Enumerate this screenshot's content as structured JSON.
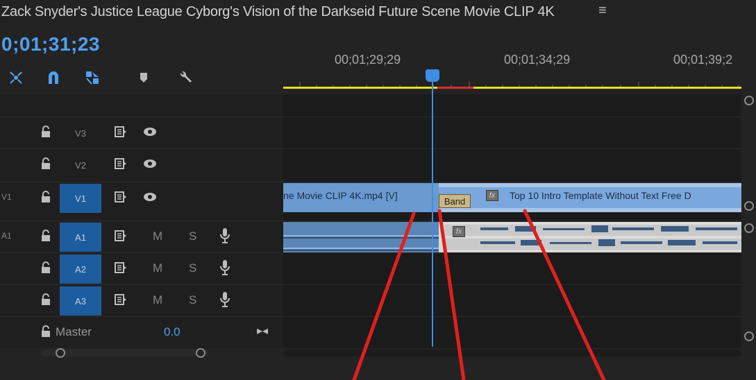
{
  "sequence": {
    "title": "Zack Snyder's Justice League Cyborg's Vision of the Darkseid Future Scene Movie CLIP 4K",
    "menu_icon": "hamburger-menu-icon"
  },
  "timecode": "0;01;31;23",
  "tools": [
    "nest-icon",
    "snap-magnet-icon",
    "linked-selection-icon",
    "add-marker-icon",
    "wrench-settings-icon"
  ],
  "ruler": {
    "labels": [
      "00;01;29;29",
      "00;01;34;29",
      "00;01;39;2"
    ]
  },
  "tracks": {
    "video": [
      {
        "name": "",
        "target": "V3",
        "active": false
      },
      {
        "name": "",
        "target": "V2",
        "active": false
      },
      {
        "name": "V1",
        "target": "V1",
        "active": true
      }
    ],
    "audio": [
      {
        "name": "A1",
        "target": "A1",
        "active": true,
        "mute": "M",
        "solo": "S"
      },
      {
        "name": "",
        "target": "A2",
        "active": false,
        "mute": "M",
        "solo": "S"
      },
      {
        "name": "",
        "target": "A3",
        "active": false,
        "mute": "M",
        "solo": "S"
      }
    ],
    "master": {
      "label": "Master",
      "value": "0.0"
    }
  },
  "clips": {
    "v1_left_label": "ne Movie CLIP 4K.mp4 [V]",
    "v1_right_label": "Top 10 Intro Template Without Text Free D",
    "band_label": "Band",
    "fx_label": "fx"
  },
  "colors": {
    "accent": "#3e8ee6",
    "workarea": "#e8e024",
    "render_red": "#d4322b",
    "annotation_red": "#e0201c"
  }
}
